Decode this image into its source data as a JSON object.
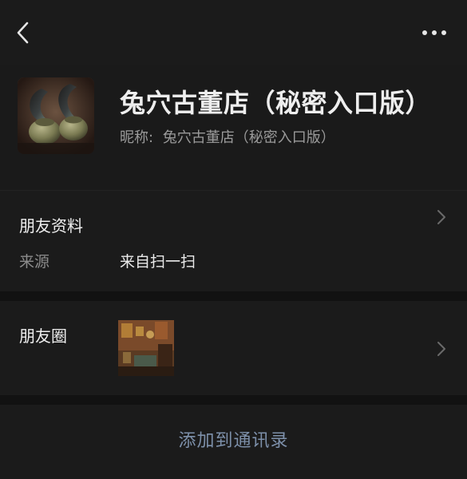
{
  "header": {
    "back_icon": "chevron-left-icon",
    "more_icon": "more-horizontal-icon"
  },
  "profile": {
    "display_name": "兔穴古董店（秘密入口版）",
    "nickname_label": "昵称:",
    "nickname_value": "兔穴古董店（秘密入口版）"
  },
  "friend_info": {
    "title": "朋友资料",
    "source_label": "来源",
    "source_value": "来自扫一扫"
  },
  "moments": {
    "title": "朋友圈"
  },
  "actions": {
    "add_to_contacts": "添加到通讯录"
  },
  "colors": {
    "background": "#1a1a1a",
    "panel": "#1b1b1b",
    "gap": "#121212",
    "link": "#7d90aa"
  }
}
